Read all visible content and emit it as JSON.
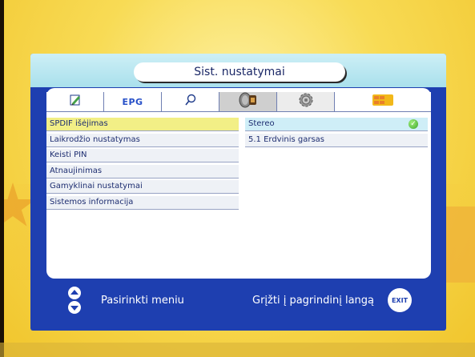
{
  "window": {
    "title": "Sist. nustatymai"
  },
  "tabs": [
    {
      "icon": "pencil-icon"
    },
    {
      "label": "EPG"
    },
    {
      "icon": "magnifier-icon"
    },
    {
      "icon": "satellite-dish-icon"
    },
    {
      "icon": "gear-icon",
      "active": true
    },
    {
      "icon": "smart-card-icon"
    }
  ],
  "menu": {
    "items": [
      {
        "label": "SPDIF išėjimas",
        "selected": true
      },
      {
        "label": "Laikrodžio nustatymas"
      },
      {
        "label": "Keisti PIN"
      },
      {
        "label": "Atnaujinimas"
      },
      {
        "label": "Gamyklinai nustatymai"
      },
      {
        "label": "Sistemos informacija"
      }
    ]
  },
  "options": {
    "items": [
      {
        "label": "Stereo",
        "selected": true,
        "icon": "check-icon"
      },
      {
        "label": "5.1 Erdvinis garsas"
      }
    ]
  },
  "footer": {
    "left_label": "Pasirinkti meniu",
    "right_label": "Grįžti į pagrindinį langą",
    "exit_label": "EXIT"
  },
  "colors": {
    "panel": "#1e3fb0",
    "selected_menu": "#f2ef86",
    "selected_option": "#cfeef7",
    "background": "#f6d23e"
  }
}
